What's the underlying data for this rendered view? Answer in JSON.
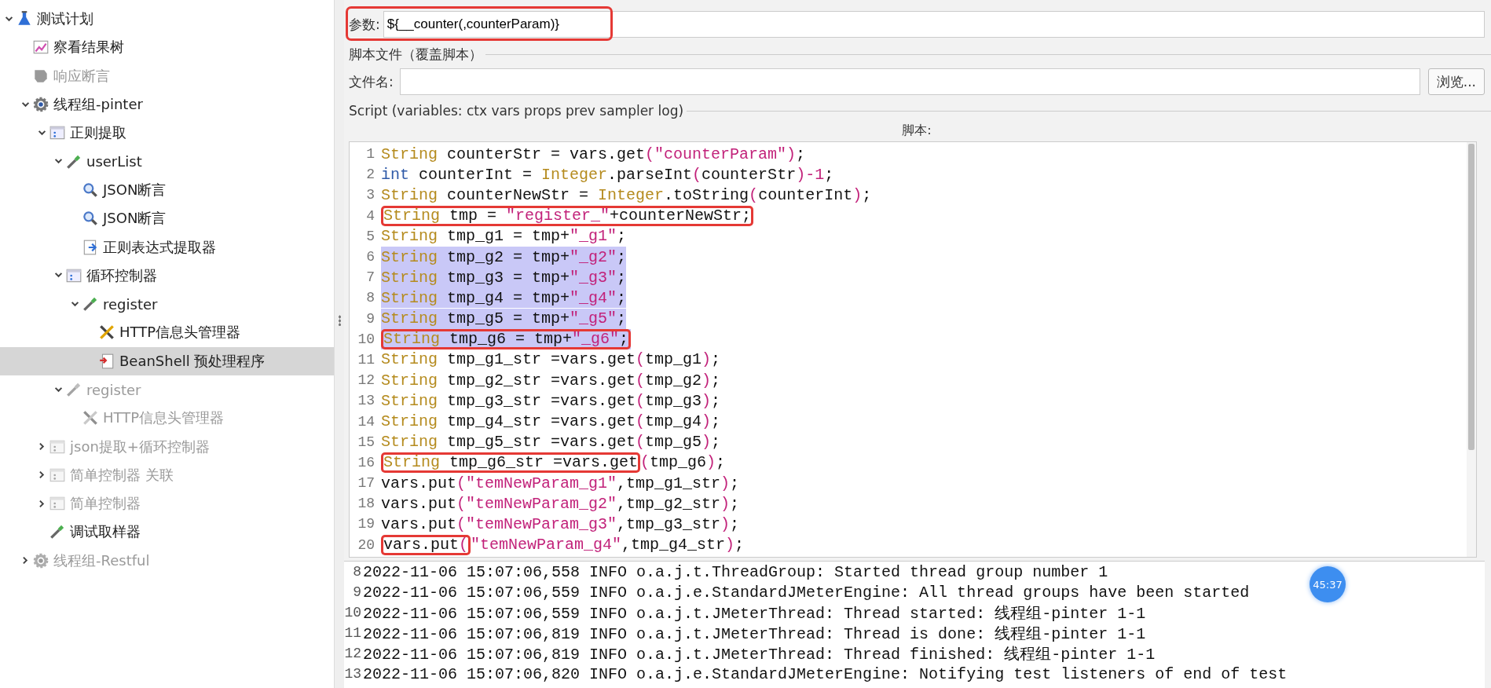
{
  "tree": [
    {
      "label": "测试计划",
      "kind": "flask",
      "disabled": false,
      "selected": false,
      "expanded": true,
      "children": [
        {
          "label": "察看结果树",
          "kind": "chart",
          "disabled": false,
          "selected": false
        },
        {
          "label": "响应断言",
          "kind": "assertion",
          "disabled": true,
          "selected": false
        },
        {
          "label": "线程组-pinter",
          "kind": "gear",
          "disabled": false,
          "selected": false,
          "expanded": true,
          "children": [
            {
              "label": "正则提取",
              "kind": "controller",
              "disabled": false,
              "selected": false,
              "expanded": true,
              "children": [
                {
                  "label": "userList",
                  "kind": "sampler",
                  "disabled": false,
                  "selected": false,
                  "expanded": true,
                  "children": [
                    {
                      "label": "JSON断言",
                      "kind": "magnifier",
                      "disabled": false,
                      "selected": false
                    },
                    {
                      "label": "JSON断言",
                      "kind": "magnifier",
                      "disabled": false,
                      "selected": false
                    },
                    {
                      "label": "正则表达式提取器",
                      "kind": "extractor",
                      "disabled": false,
                      "selected": false
                    }
                  ]
                },
                {
                  "label": "循环控制器",
                  "kind": "controller",
                  "disabled": false,
                  "selected": false,
                  "expanded": true,
                  "children": [
                    {
                      "label": "register",
                      "kind": "sampler",
                      "disabled": false,
                      "selected": false,
                      "expanded": true,
                      "children": [
                        {
                          "label": "HTTP信息头管理器",
                          "kind": "tools",
                          "disabled": false,
                          "selected": false
                        },
                        {
                          "label": "BeanShell 预处理程序",
                          "kind": "script",
                          "disabled": false,
                          "selected": true
                        }
                      ]
                    }
                  ]
                },
                {
                  "label": "register",
                  "kind": "sampler",
                  "disabled": true,
                  "selected": false,
                  "expanded": true,
                  "children": [
                    {
                      "label": "HTTP信息头管理器",
                      "kind": "tools",
                      "disabled": true,
                      "selected": false
                    }
                  ]
                }
              ]
            },
            {
              "label": "json提取+循环控制器",
              "kind": "controller",
              "disabled": true,
              "selected": false,
              "expanded": false
            },
            {
              "label": "简单控制器 关联",
              "kind": "controller",
              "disabled": true,
              "selected": false,
              "expanded": false
            },
            {
              "label": "简单控制器",
              "kind": "controller",
              "disabled": true,
              "selected": false,
              "expanded": false
            },
            {
              "label": "调试取样器",
              "kind": "sampler",
              "disabled": false,
              "selected": false
            }
          ]
        },
        {
          "label": "线程组-Restful",
          "kind": "gear",
          "disabled": true,
          "selected": false,
          "expanded": false
        }
      ]
    }
  ],
  "parameters": {
    "label": "参数:",
    "value": "${__counter(,counterParam)}",
    "annotated": true
  },
  "script_file": {
    "title": "脚本文件（覆盖脚本）",
    "label": "文件名:",
    "button": "浏览..."
  },
  "script": {
    "title": "Script (variables: ctx vars props prev sampler log)",
    "label": "脚本:",
    "lines": [
      {
        "no": "1",
        "selected": false,
        "tokens": [
          {
            "kind": "type",
            "text": "String"
          },
          {
            "kind": "plain",
            "text": " counterStr = vars.get"
          },
          {
            "kind": "literal",
            "text": "(\"counterParam\")"
          },
          {
            "kind": "plain",
            "text": ";"
          }
        ]
      },
      {
        "no": "2",
        "selected": false,
        "tokens": [
          {
            "kind": "keyword",
            "text": "int"
          },
          {
            "kind": "plain",
            "text": " counterInt = "
          },
          {
            "kind": "type",
            "text": "Integer"
          },
          {
            "kind": "plain",
            "text": ".parseInt"
          },
          {
            "kind": "literal",
            "text": "("
          },
          {
            "kind": "plain",
            "text": "counterStr"
          },
          {
            "kind": "literal",
            "text": ")-1"
          },
          {
            "kind": "plain",
            "text": ";"
          }
        ]
      },
      {
        "no": "3",
        "selected": false,
        "tokens": [
          {
            "kind": "type",
            "text": "String"
          },
          {
            "kind": "plain",
            "text": " counterNewStr = "
          },
          {
            "kind": "type",
            "text": "Integer"
          },
          {
            "kind": "plain",
            "text": ".toString"
          },
          {
            "kind": "literal",
            "text": "("
          },
          {
            "kind": "plain",
            "text": "counterInt"
          },
          {
            "kind": "literal",
            "text": ")"
          },
          {
            "kind": "plain",
            "text": ";"
          }
        ]
      },
      {
        "no": "4",
        "selected": false,
        "boxed": [
          {
            "kind": "type",
            "text": "String"
          },
          {
            "kind": "plain",
            "text": " tmp = "
          },
          {
            "kind": "literal",
            "text": "\"register_\""
          },
          {
            "kind": "plain",
            "text": "+counterNewStr;"
          }
        ]
      },
      {
        "no": "5",
        "selected": false,
        "tokens": [
          {
            "kind": "type",
            "text": "String"
          },
          {
            "kind": "plain",
            "text": " tmp_g1 = tmp+"
          },
          {
            "kind": "literal",
            "text": "\"_g1\""
          },
          {
            "kind": "plain",
            "text": ";"
          }
        ]
      },
      {
        "no": "6",
        "selected": true,
        "tokens": [
          {
            "kind": "type",
            "text": "String"
          },
          {
            "kind": "plain",
            "text": " tmp_g2 = tmp+"
          },
          {
            "kind": "literal",
            "text": "\"_g2\""
          },
          {
            "kind": "plain",
            "text": ";"
          }
        ]
      },
      {
        "no": "7",
        "selected": true,
        "tokens": [
          {
            "kind": "type",
            "text": "String"
          },
          {
            "kind": "plain",
            "text": " tmp_g3 = tmp+"
          },
          {
            "kind": "literal",
            "text": "\"_g3\""
          },
          {
            "kind": "plain",
            "text": ";"
          }
        ]
      },
      {
        "no": "8",
        "selected": true,
        "tokens": [
          {
            "kind": "type",
            "text": "String"
          },
          {
            "kind": "plain",
            "text": " tmp_g4 = tmp+"
          },
          {
            "kind": "literal",
            "text": "\"_g4\""
          },
          {
            "kind": "plain",
            "text": ";"
          }
        ]
      },
      {
        "no": "9",
        "selected": true,
        "tokens": [
          {
            "kind": "type",
            "text": "String"
          },
          {
            "kind": "plain",
            "text": " tmp_g5 = tmp+"
          },
          {
            "kind": "literal",
            "text": "\"_g5\""
          },
          {
            "kind": "plain",
            "text": ";"
          }
        ]
      },
      {
        "no": "10",
        "selected": true,
        "boxed": [
          {
            "kind": "type",
            "text": "String"
          },
          {
            "kind": "plain",
            "text": " tmp_g6 = tmp+"
          },
          {
            "kind": "literal",
            "text": "\"_g6\""
          },
          {
            "kind": "plain",
            "text": ";"
          }
        ]
      },
      {
        "no": "11",
        "selected": false,
        "tokens": [
          {
            "kind": "type",
            "text": "String"
          },
          {
            "kind": "plain",
            "text": " tmp_g1_str =vars.get"
          },
          {
            "kind": "literal",
            "text": "("
          },
          {
            "kind": "plain",
            "text": "tmp_g1"
          },
          {
            "kind": "literal",
            "text": ")"
          },
          {
            "kind": "plain",
            "text": ";"
          }
        ]
      },
      {
        "no": "12",
        "selected": false,
        "tokens": [
          {
            "kind": "type",
            "text": "String"
          },
          {
            "kind": "plain",
            "text": " tmp_g2_str =vars.get"
          },
          {
            "kind": "literal",
            "text": "("
          },
          {
            "kind": "plain",
            "text": "tmp_g2"
          },
          {
            "kind": "literal",
            "text": ")"
          },
          {
            "kind": "plain",
            "text": ";"
          }
        ]
      },
      {
        "no": "13",
        "selected": false,
        "tokens": [
          {
            "kind": "type",
            "text": "String"
          },
          {
            "kind": "plain",
            "text": " tmp_g3_str =vars.get"
          },
          {
            "kind": "literal",
            "text": "("
          },
          {
            "kind": "plain",
            "text": "tmp_g3"
          },
          {
            "kind": "literal",
            "text": ")"
          },
          {
            "kind": "plain",
            "text": ";"
          }
        ]
      },
      {
        "no": "14",
        "selected": false,
        "tokens": [
          {
            "kind": "type",
            "text": "String"
          },
          {
            "kind": "plain",
            "text": " tmp_g4_str =vars.get"
          },
          {
            "kind": "literal",
            "text": "("
          },
          {
            "kind": "plain",
            "text": "tmp_g4"
          },
          {
            "kind": "literal",
            "text": ")"
          },
          {
            "kind": "plain",
            "text": ";"
          }
        ]
      },
      {
        "no": "15",
        "selected": false,
        "tokens": [
          {
            "kind": "type",
            "text": "String"
          },
          {
            "kind": "plain",
            "text": " tmp_g5_str =vars.get"
          },
          {
            "kind": "literal",
            "text": "("
          },
          {
            "kind": "plain",
            "text": "tmp_g5"
          },
          {
            "kind": "literal",
            "text": ")"
          },
          {
            "kind": "plain",
            "text": ";"
          }
        ]
      },
      {
        "no": "16",
        "selected": false,
        "boxed": [
          {
            "kind": "type",
            "text": "String"
          },
          {
            "kind": "plain",
            "text": " tmp_g6_str =vars.get"
          }
        ],
        "tokens": [
          {
            "kind": "literal",
            "text": "("
          },
          {
            "kind": "plain",
            "text": "tmp_g6"
          },
          {
            "kind": "literal",
            "text": ")"
          },
          {
            "kind": "plain",
            "text": ";"
          }
        ]
      },
      {
        "no": "17",
        "selected": false,
        "tokens": [
          {
            "kind": "plain",
            "text": "vars.put"
          },
          {
            "kind": "literal",
            "text": "(\"temNewParam_g1\""
          },
          {
            "kind": "plain",
            "text": ",tmp_g1_str"
          },
          {
            "kind": "literal",
            "text": ")"
          },
          {
            "kind": "plain",
            "text": ";"
          }
        ]
      },
      {
        "no": "18",
        "selected": false,
        "tokens": [
          {
            "kind": "plain",
            "text": "vars.put"
          },
          {
            "kind": "literal",
            "text": "(\"temNewParam_g2\""
          },
          {
            "kind": "plain",
            "text": ",tmp_g2_str"
          },
          {
            "kind": "literal",
            "text": ")"
          },
          {
            "kind": "plain",
            "text": ";"
          }
        ]
      },
      {
        "no": "19",
        "selected": false,
        "tokens": [
          {
            "kind": "plain",
            "text": "vars.put"
          },
          {
            "kind": "literal",
            "text": "(\"temNewParam_g3\""
          },
          {
            "kind": "plain",
            "text": ",tmp_g3_str"
          },
          {
            "kind": "literal",
            "text": ")"
          },
          {
            "kind": "plain",
            "text": ";"
          }
        ]
      },
      {
        "no": "20",
        "selected": false,
        "boxed": [
          {
            "kind": "plain",
            "text": "vars.put"
          },
          {
            "kind": "literal",
            "text": "("
          }
        ],
        "tokens": [
          {
            "kind": "literal",
            "text": "\"temNewParam_g4\""
          },
          {
            "kind": "plain",
            "text": ",tmp_g4_str"
          },
          {
            "kind": "literal",
            "text": ")"
          },
          {
            "kind": "plain",
            "text": ";"
          }
        ]
      }
    ]
  },
  "log": {
    "lines": [
      {
        "no": "8",
        "text": "2022-11-06 15:07:06,558 INFO o.a.j.t.ThreadGroup: Started thread group number 1"
      },
      {
        "no": "9",
        "text": "2022-11-06 15:07:06,559 INFO o.a.j.e.StandardJMeterEngine: All thread groups have been started"
      },
      {
        "no": "10",
        "text": "2022-11-06 15:07:06,559 INFO o.a.j.t.JMeterThread: Thread started: 线程组-pinter 1-1"
      },
      {
        "no": "11",
        "text": "2022-11-06 15:07:06,819 INFO o.a.j.t.JMeterThread: Thread is done: 线程组-pinter 1-1"
      },
      {
        "no": "12",
        "text": "2022-11-06 15:07:06,819 INFO o.a.j.t.JMeterThread: Thread finished: 线程组-pinter 1-1"
      },
      {
        "no": "13",
        "text": "2022-11-06 15:07:06,820 INFO o.a.j.e.StandardJMeterEngine: Notifying test listeners of end of test"
      }
    ]
  },
  "timer_badge": "45:37"
}
